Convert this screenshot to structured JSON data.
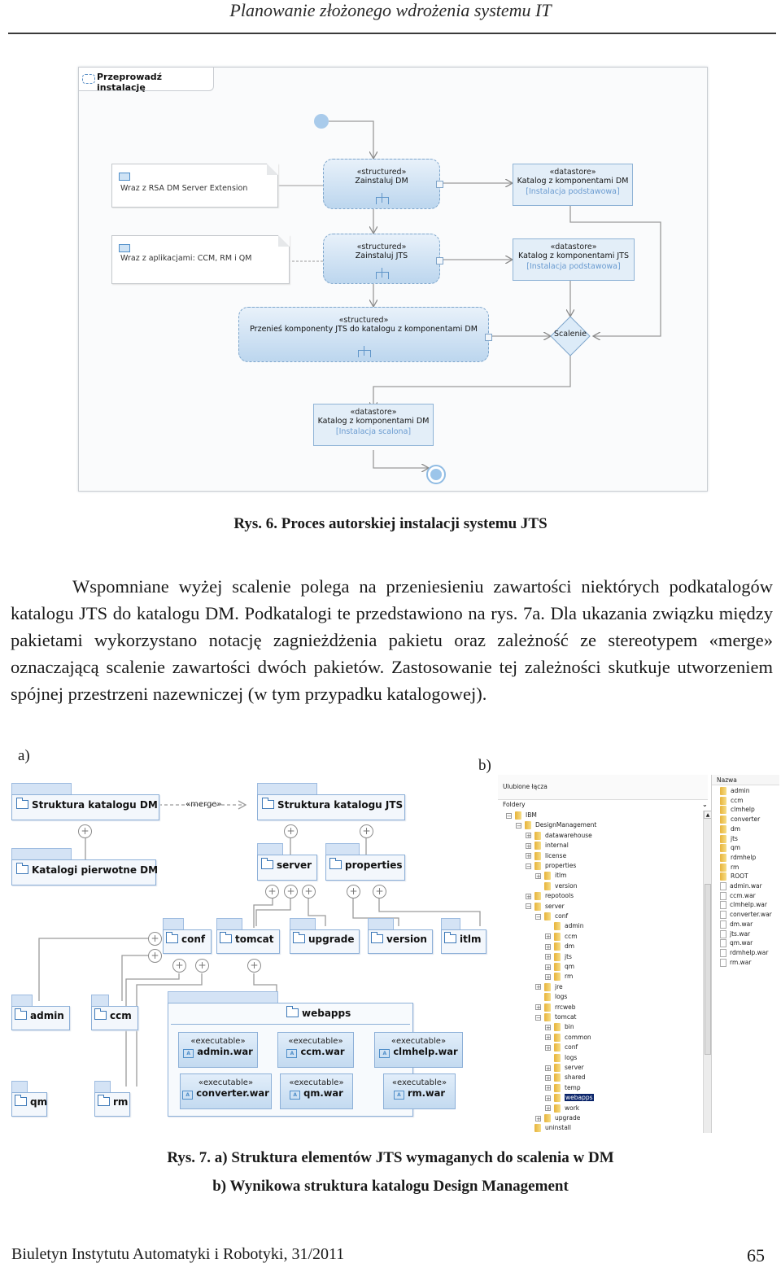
{
  "running_head": "Planowanie złożonego wdrożenia systemu IT",
  "figure6": {
    "frame_title": "Przeprowadź instalację",
    "notes": [
      {
        "text": "Wraz z RSA DM Server Extension"
      },
      {
        "text": "Wraz z aplikacjami: CCM, RM i QM"
      }
    ],
    "actions": [
      {
        "stereotype": "«structured»",
        "name": "Zainstaluj DM"
      },
      {
        "stereotype": "«structured»",
        "name": "Zainstaluj JTS"
      },
      {
        "stereotype": "«structured»",
        "name": "Przenieś komponenty JTS do katalogu z komponentami DM"
      }
    ],
    "datastores": [
      {
        "stereotype": "«datastore»",
        "name": "Katalog z komponentami DM",
        "guard": "[Instalacja podstawowa]"
      },
      {
        "stereotype": "«datastore»",
        "name": "Katalog z komponentami JTS",
        "guard": "[Instalacja podstawowa]"
      },
      {
        "stereotype": "«datastore»",
        "name": "Katalog z komponentami DM",
        "guard": "[Instalacja scalona]"
      }
    ],
    "merge_node": "Scalenie",
    "caption": "Rys. 6. Proces autorskiej instalacji systemu JTS"
  },
  "paragraph": "Wspomniane wyżej scalenie polega na przeniesieniu zawartości niektórych podkatalogów katalogu JTS do katalogu DM. Podkatalogi te przedstawiono na rys. 7a. Dla ukazania związku między pakietami wykorzystano notację zagnieżdżenia pakietu oraz zależność ze stereotypem «merge» oznaczającą scalenie zawartości dwóch pakietów. Zastosowanie tej zależności skutkuje utworzeniem spójnej przestrzeni nazewniczej (w tym przypadku katalogowej).",
  "figure7": {
    "label_a": "a)",
    "label_b": "b)",
    "packages": {
      "dm_root": "Struktura katalogu DM",
      "dm_original": "Katalogi pierwotne DM",
      "merge_label": "«merge»",
      "jts_root": "Struktura katalogu JTS",
      "server": "server",
      "properties": "properties",
      "conf": "conf",
      "tomcat": "tomcat",
      "upgrade": "upgrade",
      "version": "version",
      "itlm": "itlm",
      "admin": "admin",
      "ccm": "ccm",
      "qm": "qm",
      "rm": "rm",
      "webapps": "webapps"
    },
    "executables": [
      {
        "stereotype": "«executable»",
        "name": "admin.war"
      },
      {
        "stereotype": "«executable»",
        "name": "ccm.war"
      },
      {
        "stereotype": "«executable»",
        "name": "clmhelp.war"
      },
      {
        "stereotype": "«executable»",
        "name": "converter.war"
      },
      {
        "stereotype": "«executable»",
        "name": "qm.war"
      },
      {
        "stereotype": "«executable»",
        "name": "rm.war"
      }
    ],
    "explorer": {
      "favorites_label": "Ulubione łącza",
      "folders_label": "Foldery",
      "tree": [
        {
          "label": "IBM",
          "toggle": "−"
        },
        {
          "label": "DesignManagement",
          "toggle": "−"
        },
        {
          "label": "datawarehouse",
          "toggle": "+"
        },
        {
          "label": "internal",
          "toggle": "+"
        },
        {
          "label": "license",
          "toggle": "+"
        },
        {
          "label": "properties",
          "toggle": "−"
        },
        {
          "label": "itlm",
          "toggle": "+"
        },
        {
          "label": "version",
          "toggle": ""
        },
        {
          "label": "repotools",
          "toggle": "+"
        },
        {
          "label": "server",
          "toggle": "−"
        },
        {
          "label": "conf",
          "toggle": "−"
        },
        {
          "label": "admin",
          "toggle": ""
        },
        {
          "label": "ccm",
          "toggle": "+"
        },
        {
          "label": "dm",
          "toggle": "+"
        },
        {
          "label": "jts",
          "toggle": "+"
        },
        {
          "label": "qm",
          "toggle": "+"
        },
        {
          "label": "rm",
          "toggle": "+"
        },
        {
          "label": "jre",
          "toggle": "+"
        },
        {
          "label": "logs",
          "toggle": ""
        },
        {
          "label": "rrcweb",
          "toggle": "+"
        },
        {
          "label": "tomcat",
          "toggle": "−"
        },
        {
          "label": "bin",
          "toggle": "+"
        },
        {
          "label": "common",
          "toggle": "+"
        },
        {
          "label": "conf",
          "toggle": "+"
        },
        {
          "label": "logs",
          "toggle": ""
        },
        {
          "label": "server",
          "toggle": "+"
        },
        {
          "label": "shared",
          "toggle": "+"
        },
        {
          "label": "temp",
          "toggle": "+"
        },
        {
          "label": "webapps",
          "toggle": "+",
          "selected": true
        },
        {
          "label": "work",
          "toggle": "+"
        },
        {
          "label": "upgrade",
          "toggle": "+"
        },
        {
          "label": "uninstall",
          "toggle": ""
        }
      ],
      "list_header": "Nazwa",
      "list_folders": [
        "admin",
        "ccm",
        "clmhelp",
        "converter",
        "dm",
        "jts",
        "qm",
        "rdmhelp",
        "rm",
        "ROOT"
      ],
      "list_files": [
        "admin.war",
        "ccm.war",
        "clmhelp.war",
        "converter.war",
        "dm.war",
        "jts.war",
        "qm.war",
        "rdmhelp.war",
        "rm.war"
      ]
    },
    "caption_line1": "Rys. 7. a) Struktura elementów JTS wymaganych do scalenia w DM",
    "caption_line2": "b) Wynikowa struktura katalogu Design Management"
  },
  "footer": {
    "journal": "Biuletyn Instytutu Automatyki i Robotyki, 31/2011",
    "page_number": "65"
  }
}
